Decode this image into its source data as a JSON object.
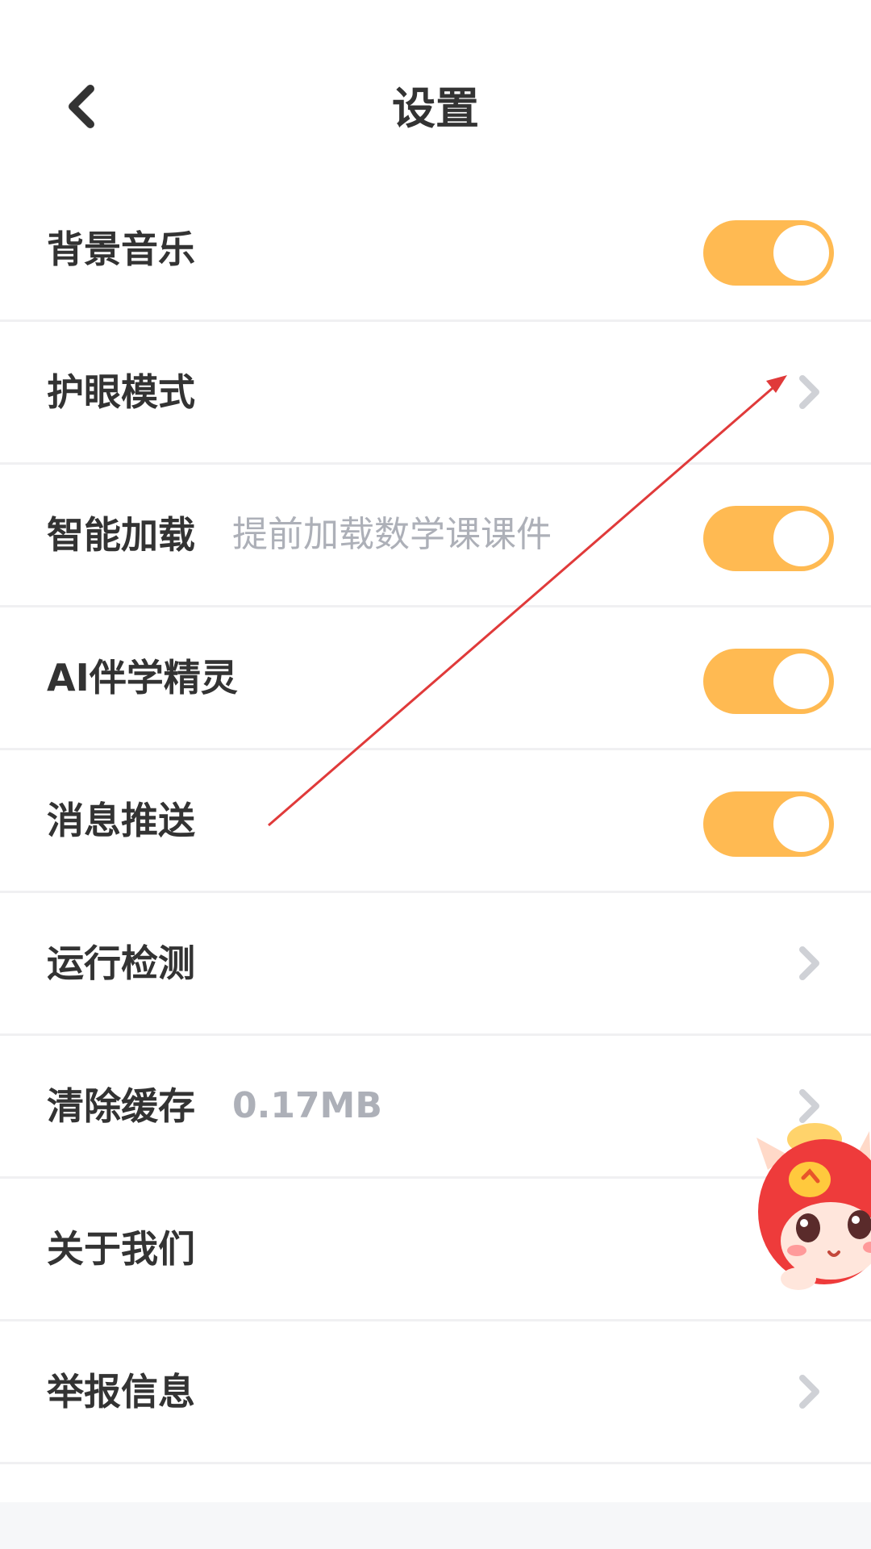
{
  "header": {
    "title": "设置"
  },
  "settings": [
    {
      "label": "背景音乐",
      "subtitle": "",
      "control": "toggle",
      "on": true
    },
    {
      "label": "护眼模式",
      "subtitle": "",
      "control": "chevron"
    },
    {
      "label": "智能加载",
      "subtitle": "提前加载数学课课件",
      "control": "toggle",
      "on": true
    },
    {
      "label": "AI伴学精灵",
      "subtitle": "",
      "control": "toggle",
      "on": true
    },
    {
      "label": "消息推送",
      "subtitle": "",
      "control": "toggle",
      "on": true
    },
    {
      "label": "运行检测",
      "subtitle": "",
      "control": "chevron"
    },
    {
      "label": "清除缓存",
      "subtitle": "0.17MB",
      "control": "chevron"
    },
    {
      "label": "关于我们",
      "subtitle": "",
      "control": "chevron"
    },
    {
      "label": "举报信息",
      "subtitle": "",
      "control": "chevron"
    }
  ],
  "icons": {
    "back": "chevron-left-icon",
    "row_arrow": "chevron-right-icon",
    "mascot": "red-cat-mascot"
  },
  "colors": {
    "toggle_on": "#ffba52",
    "text_primary": "#333333",
    "text_secondary": "#adb0b8",
    "divider": "#f0f0f2",
    "chevron": "#cfd1d6",
    "annotation": "#e03a3a"
  }
}
